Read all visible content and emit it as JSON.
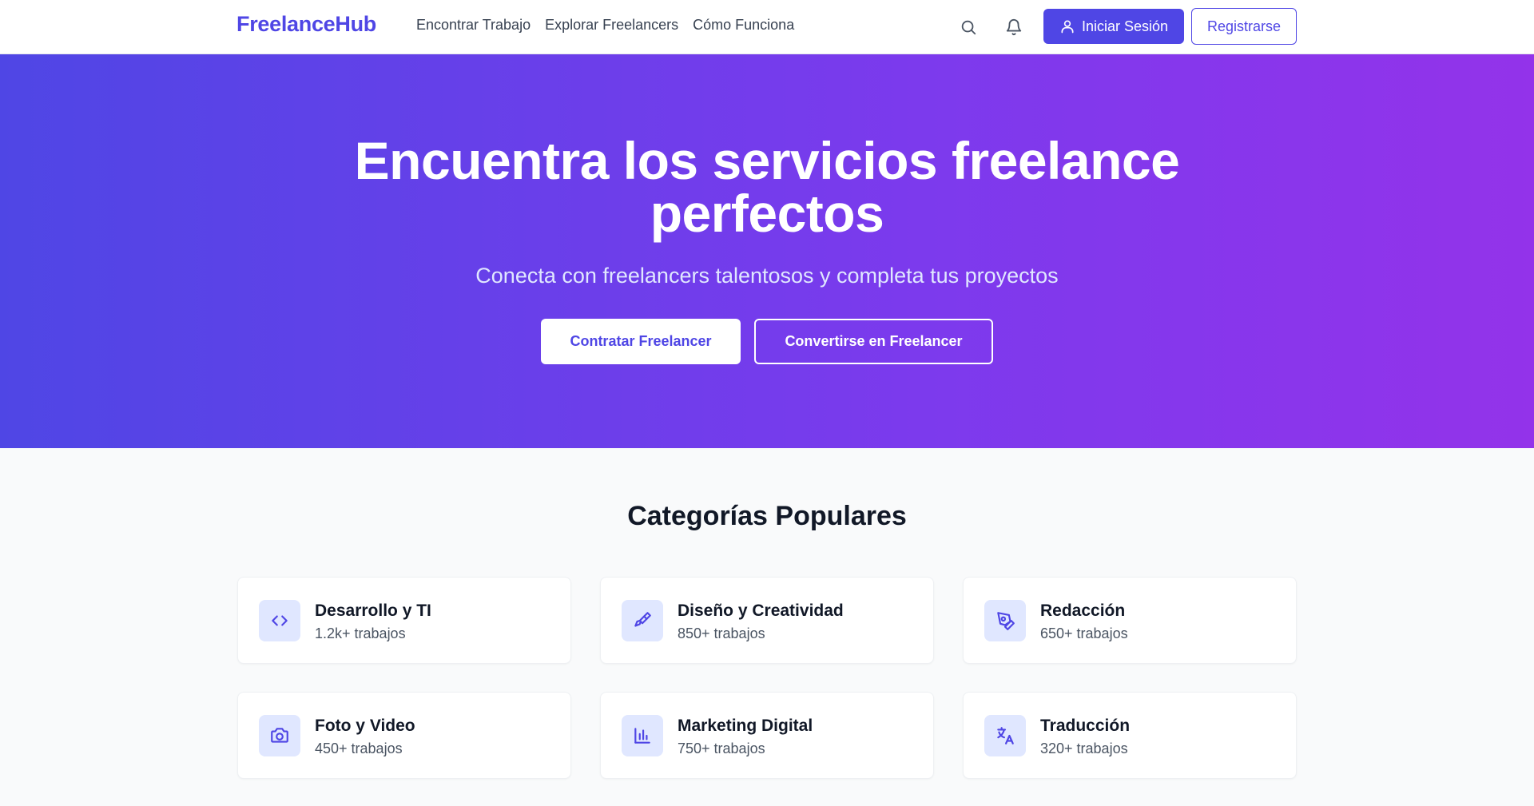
{
  "header": {
    "brand": "FreelanceHub",
    "nav": [
      "Encontrar Trabajo",
      "Explorar Freelancers",
      "Cómo Funciona"
    ],
    "login_label": "Iniciar Sesión",
    "register_label": "Registrarse"
  },
  "hero": {
    "title_line1": "Encuentra los servicios freelance",
    "title_line2": "perfectos",
    "subtitle": "Conecta con freelancers talentosos y completa tus proyectos",
    "hire_label": "Contratar Freelancer",
    "become_label": "Convertirse en Freelancer"
  },
  "categories": {
    "title": "Categorías Populares",
    "items": [
      {
        "name": "Desarrollo y TI",
        "count": "1.2k+ trabajos",
        "icon": "code-icon"
      },
      {
        "name": "Diseño y Creatividad",
        "count": "850+ trabajos",
        "icon": "paintbrush-icon"
      },
      {
        "name": "Redacción",
        "count": "650+ trabajos",
        "icon": "pen-tool-icon"
      },
      {
        "name": "Foto y Video",
        "count": "450+ trabajos",
        "icon": "camera-icon"
      },
      {
        "name": "Marketing Digital",
        "count": "750+ trabajos",
        "icon": "bar-chart-icon"
      },
      {
        "name": "Traducción",
        "count": "320+ trabajos",
        "icon": "languages-icon"
      }
    ]
  },
  "colors": {
    "accent": "#4f46e5",
    "gradient_start": "#4f46e5",
    "gradient_end": "#9333ea"
  }
}
